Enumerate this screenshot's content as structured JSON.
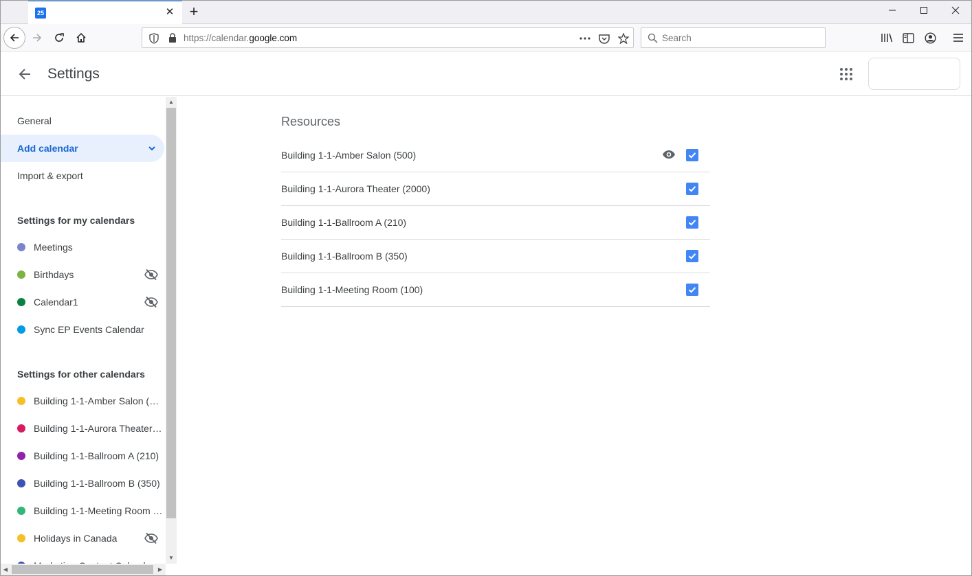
{
  "browser": {
    "tab_favicon_text": "25",
    "url_prefix": "https://calendar.",
    "url_domain": "google.com",
    "search_placeholder": "Search"
  },
  "header": {
    "title": "Settings"
  },
  "sidebar": {
    "nav": [
      {
        "label": "General"
      },
      {
        "label": "Add calendar"
      },
      {
        "label": "Import & export"
      }
    ],
    "my_calendars_heading": "Settings for my calendars",
    "my_calendars": [
      {
        "name": "Meetings",
        "color": "#7986cb",
        "hidden": false
      },
      {
        "name": "Birthdays",
        "color": "#7cb342",
        "hidden": true
      },
      {
        "name": "Calendar1",
        "color": "#0b8043",
        "hidden": true
      },
      {
        "name": "Sync EP Events Calendar",
        "color": "#039be5",
        "hidden": false
      }
    ],
    "other_calendars_heading": "Settings for other calendars",
    "other_calendars": [
      {
        "name": "Building 1-1-Amber Salon (500)",
        "color": "#f6bf26",
        "hidden": false
      },
      {
        "name": "Building 1-1-Aurora Theater (2000)",
        "color": "#d81b60",
        "hidden": false
      },
      {
        "name": "Building 1-1-Ballroom A (210)",
        "color": "#8e24aa",
        "hidden": false
      },
      {
        "name": "Building 1-1-Ballroom B (350)",
        "color": "#3f51b5",
        "hidden": false
      },
      {
        "name": "Building 1-1-Meeting Room (100)",
        "color": "#33b679",
        "hidden": false
      },
      {
        "name": "Holidays in Canada",
        "color": "#f6bf26",
        "hidden": true
      },
      {
        "name": "Marketing Content Calendar",
        "color": "#3f51b5",
        "hidden": false
      }
    ]
  },
  "main": {
    "title": "Resources",
    "resources": [
      {
        "name": "Building 1-1-Amber Salon (500)",
        "checked": true,
        "show_eye": true
      },
      {
        "name": "Building 1-1-Aurora Theater (2000)",
        "checked": true,
        "show_eye": false
      },
      {
        "name": "Building 1-1-Ballroom A (210)",
        "checked": true,
        "show_eye": false
      },
      {
        "name": "Building 1-1-Ballroom B (350)",
        "checked": true,
        "show_eye": false
      },
      {
        "name": "Building 1-1-Meeting Room (100)",
        "checked": true,
        "show_eye": false
      }
    ]
  }
}
